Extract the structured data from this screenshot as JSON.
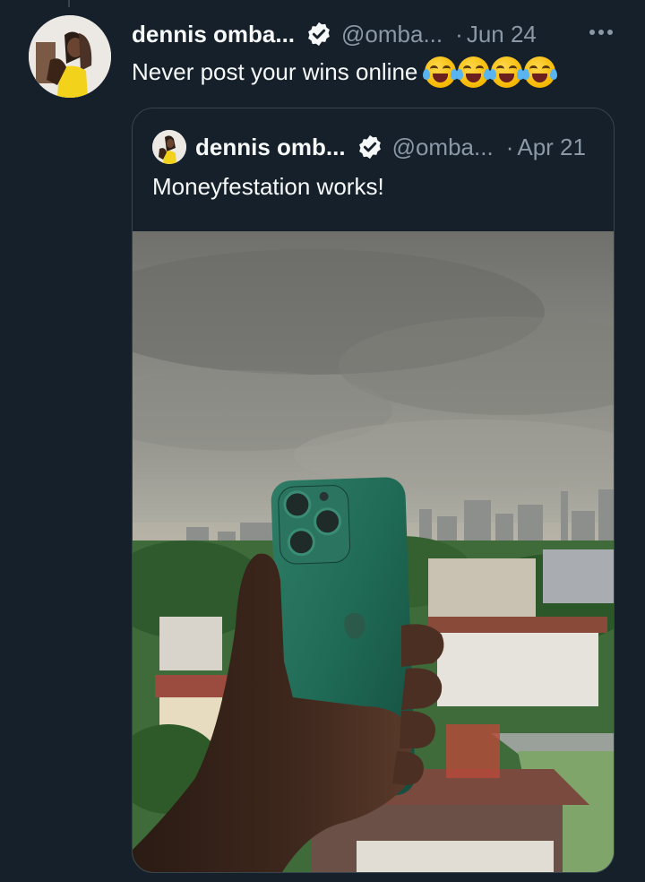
{
  "tweet": {
    "author_name": "dennis omba...",
    "handle": "@omba...",
    "separator": "·",
    "date": "Jun 24",
    "text": "Never post your wins online",
    "emoji": [
      "face-with-tears-of-joy",
      "face-with-tears-of-joy",
      "face-with-tears-of-joy",
      "face-with-tears-of-joy"
    ]
  },
  "quoted_tweet": {
    "author_name": "dennis omb...",
    "handle": "@omba...",
    "separator": "·",
    "date": "Apr 21",
    "text": "Moneyfestation works!",
    "image": "photo-hand-holding-green-iphone-over-city"
  },
  "icons": {
    "verified": "verified-badge-icon",
    "more": "more-options-icon"
  },
  "colors": {
    "background": "#15202b",
    "text": "#f7f9f9",
    "muted": "#8b98a5",
    "border": "#38444d"
  }
}
